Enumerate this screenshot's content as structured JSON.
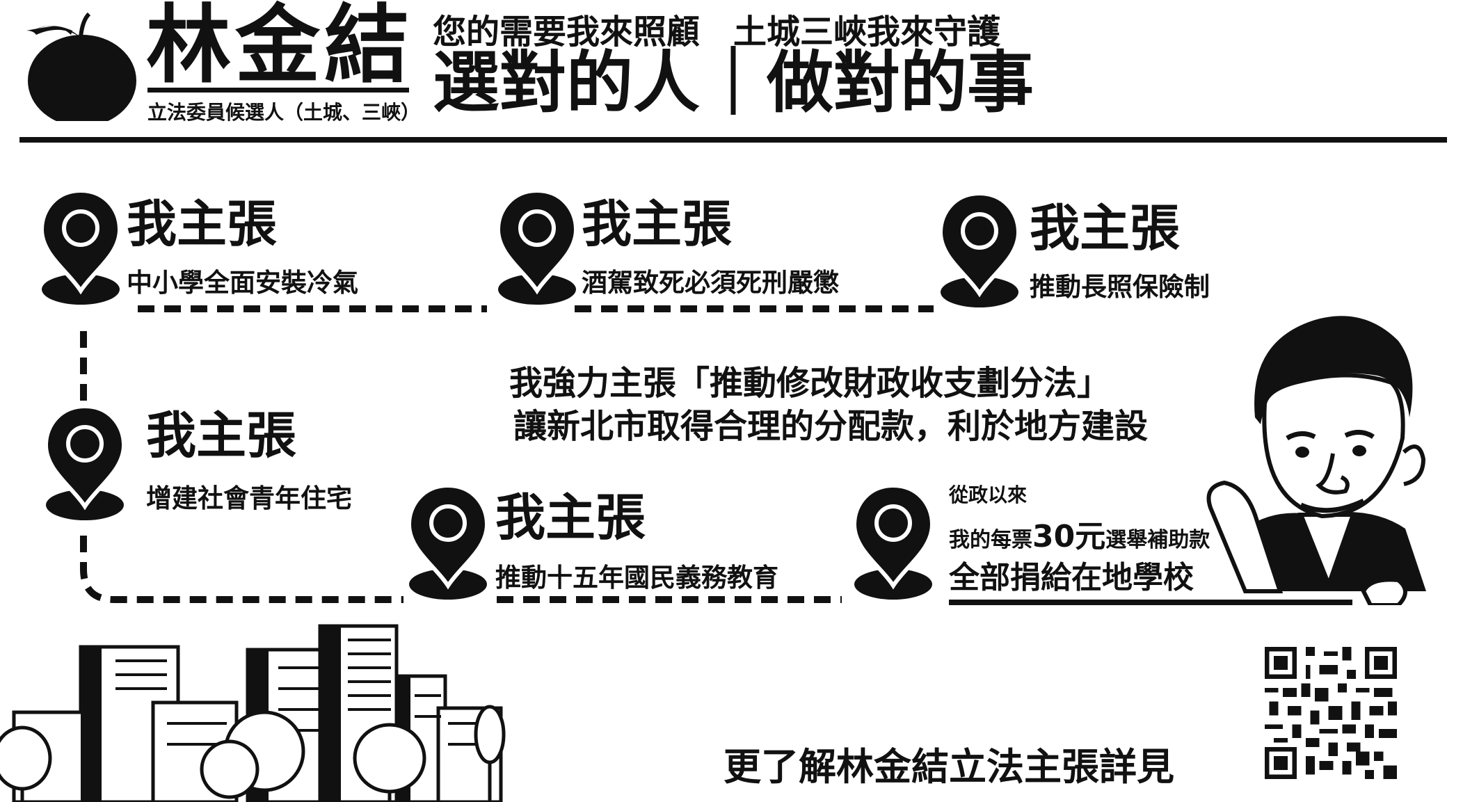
{
  "header": {
    "name": "林金結",
    "subtitle": "立法委員候選人（土城、三峽）",
    "slogan_line1": "您的需要我來照顧　土城三峽我來守護",
    "slogan_line2": "選對的人｜做對的事"
  },
  "points": [
    {
      "title": "我主張",
      "text": "中小學全面安裝冷氣"
    },
    {
      "title": "我主張",
      "text": "酒駕致死必須死刑嚴懲"
    },
    {
      "title": "我主張",
      "text": "推動長照保險制"
    },
    {
      "title": "我主張",
      "text": "增建社會青年住宅"
    },
    {
      "title": "我主張",
      "text": "推動十五年國民義務教育"
    }
  ],
  "highlight": {
    "line1": "我強力主張「推動修改財政收支劃分法」",
    "line2": "讓新北市取得合理的分配款，利於地方建設"
  },
  "donation": {
    "line1": "從政以來",
    "line2_prefix": "我的每票",
    "line2_amount": "30元",
    "line2_suffix": "選舉補助款",
    "line3": "全部捐給在地學校"
  },
  "footer": {
    "more_text": "更了解林金結立法主張詳見"
  },
  "icons": [
    "orange-logo-icon",
    "location-pin-icon",
    "qr-code-icon",
    "city-buildings-icon",
    "candidate-portrait-icon"
  ],
  "colors": {
    "ink": "#111111",
    "background": "#ffffff"
  }
}
